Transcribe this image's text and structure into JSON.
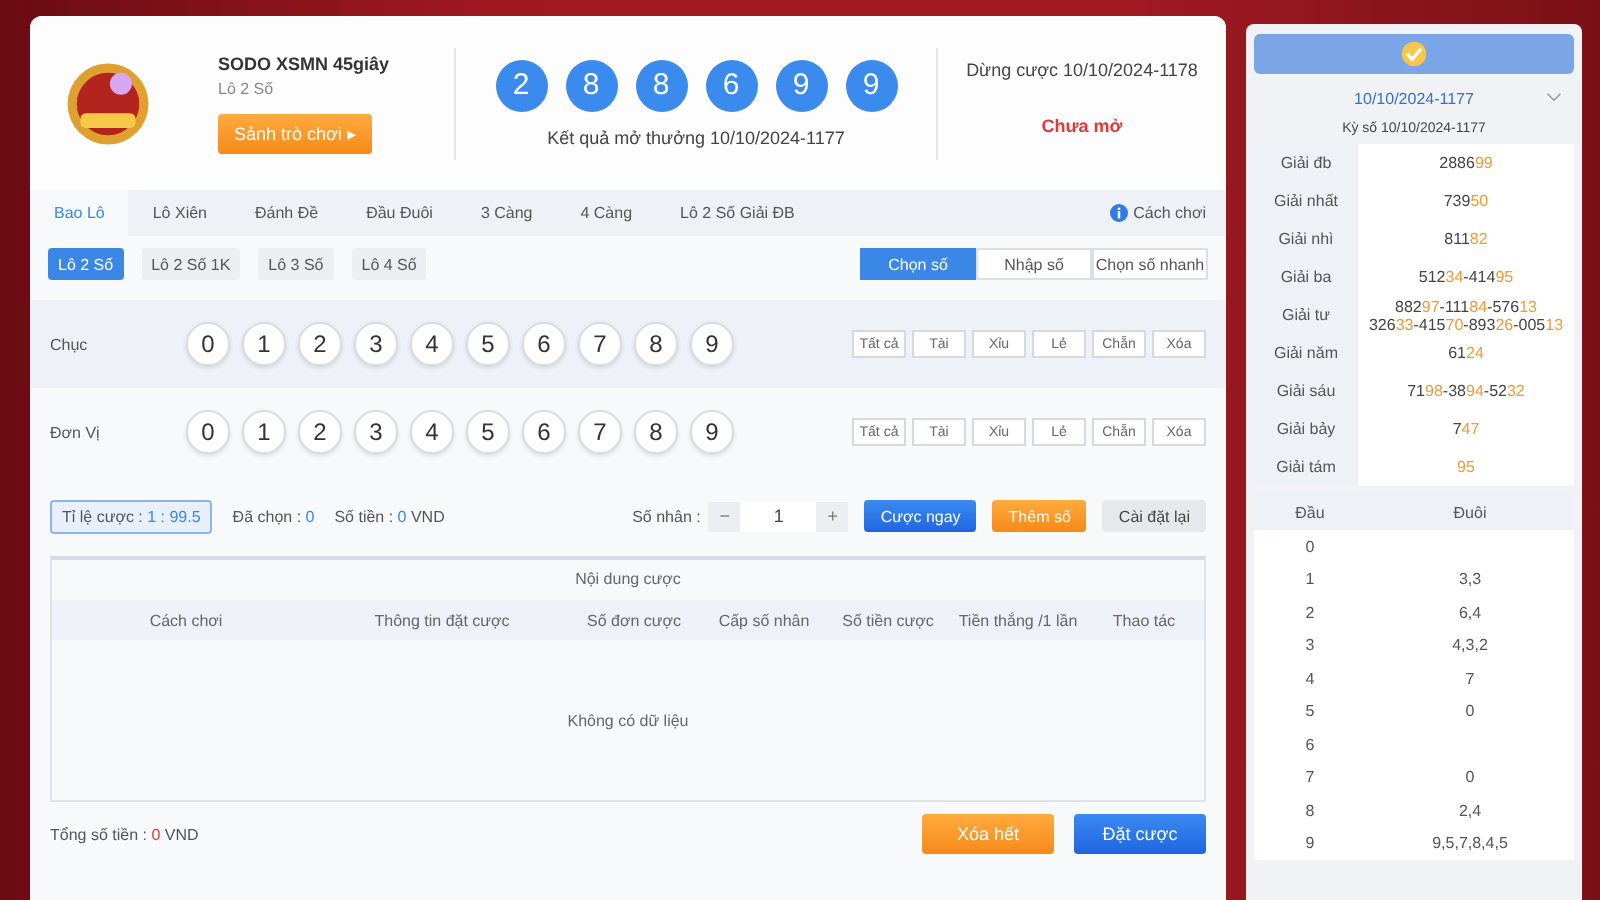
{
  "game": {
    "title": "SODO XSMN 45giây",
    "subtitle": "Lô 2 Số",
    "lobby_button": "Sảnh trò chơi ▸"
  },
  "result": {
    "balls": [
      "2",
      "8",
      "8",
      "6",
      "9",
      "9"
    ],
    "caption": "Kết quả mở thưởng 10/10/2024-1177"
  },
  "next_draw": {
    "label": "Dừng cược 10/10/2024-1178",
    "status": "Chưa mở"
  },
  "tabs": [
    {
      "label": "Bao Lô",
      "selected": true
    },
    {
      "label": "Lô Xiên",
      "selected": false
    },
    {
      "label": "Đánh Đề",
      "selected": false
    },
    {
      "label": "Đầu Đuôi",
      "selected": false
    },
    {
      "label": "3 Càng",
      "selected": false
    },
    {
      "label": "4 Càng",
      "selected": false
    },
    {
      "label": "Lô 2 Số Giải ĐB",
      "selected": false
    }
  ],
  "help_link": "Cách chơi",
  "subtabs": [
    {
      "label": "Lô 2 Số",
      "selected": true
    },
    {
      "label": "Lô 2 Số 1K",
      "selected": false
    },
    {
      "label": "Lô 3 Số",
      "selected": false
    },
    {
      "label": "Lô 4 Số",
      "selected": false
    }
  ],
  "modes": [
    {
      "label": "Chọn số",
      "selected": true
    },
    {
      "label": "Nhập số",
      "selected": false
    },
    {
      "label": "Chọn số nhanh",
      "selected": false
    }
  ],
  "digit_rows": [
    {
      "label": "Chục",
      "digits": [
        {
          "label": "0",
          "selected": false
        },
        {
          "label": "1",
          "selected": false
        },
        {
          "label": "2",
          "selected": false
        },
        {
          "label": "3",
          "selected": false
        },
        {
          "label": "4",
          "selected": false
        },
        {
          "label": "5",
          "selected": false
        },
        {
          "label": "6",
          "selected": false
        },
        {
          "label": "7",
          "selected": false
        },
        {
          "label": "8",
          "selected": false
        },
        {
          "label": "9",
          "selected": false
        }
      ],
      "filters": [
        "Tất cả",
        "Tài",
        "Xỉu",
        "Lẻ",
        "Chẵn",
        "Xóa"
      ]
    },
    {
      "label": "Đơn Vị",
      "digits": [
        {
          "label": "0",
          "selected": false
        },
        {
          "label": "1",
          "selected": false
        },
        {
          "label": "2",
          "selected": false
        },
        {
          "label": "3",
          "selected": false
        },
        {
          "label": "4",
          "selected": false
        },
        {
          "label": "5",
          "selected": false
        },
        {
          "label": "6",
          "selected": false
        },
        {
          "label": "7",
          "selected": false
        },
        {
          "label": "8",
          "selected": false
        },
        {
          "label": "9",
          "selected": false
        }
      ],
      "filters": [
        "Tất cả",
        "Tài",
        "Xỉu",
        "Lẻ",
        "Chẵn",
        "Xóa"
      ]
    }
  ],
  "bet_bar": {
    "odds_label": "Tỉ lệ cược : ",
    "odds_value": "1 : 99.5",
    "chosen_label": "Đã chọn : ",
    "chosen_value": "0",
    "amount_label": "Số tiền : ",
    "amount_value": "0",
    "amount_unit": " VND",
    "multiplier_label": "Số nhân :",
    "minus": "−",
    "multiplier": "1",
    "plus": "+",
    "buttons": [
      {
        "label": "Cược ngay",
        "kind": "primary"
      },
      {
        "label": "Thêm số",
        "kind": "warning"
      },
      {
        "label": "Cài đặt lại",
        "kind": "plain"
      }
    ]
  },
  "bet_table": {
    "title": "Nội dung cược",
    "columns": [
      "Cách chơi",
      "Thông tin đặt cược",
      "Số đơn cược",
      "Cấp số nhân",
      "Số tiền cược",
      "Tiền thắng /1 lần",
      "Thao tác"
    ],
    "empty": "Không có dữ liệu"
  },
  "footer": {
    "total_label": "Tổng số tiền : ",
    "total_value": "0",
    "total_unit": " VND",
    "buttons": [
      {
        "label": "Xóa hết",
        "kind": "warning"
      },
      {
        "label": "Đặt cược",
        "kind": "primary"
      }
    ]
  },
  "results_panel": {
    "date": "10/10/2024-1177",
    "draw": "Kỳ số 10/10/2024-1177",
    "separator": "-",
    "prizes": [
      {
        "name": "Giải đb",
        "lines": [
          [
            [
              "2886",
              "99"
            ]
          ]
        ]
      },
      {
        "name": "Giải nhất",
        "lines": [
          [
            [
              "739",
              "50"
            ]
          ]
        ]
      },
      {
        "name": "Giải nhì",
        "lines": [
          [
            [
              "811",
              "82"
            ]
          ]
        ]
      },
      {
        "name": "Giải ba",
        "lines": [
          [
            [
              "512",
              "34"
            ],
            [
              "414",
              "95"
            ]
          ]
        ]
      },
      {
        "name": "Giải tư",
        "lines": [
          [
            [
              "882",
              "97"
            ],
            [
              "111",
              "84"
            ],
            [
              "576",
              "13"
            ]
          ],
          [
            [
              "326",
              "33"
            ],
            [
              "415",
              "70"
            ],
            [
              "893",
              "26"
            ],
            [
              "005",
              "13"
            ]
          ]
        ]
      },
      {
        "name": "Giải năm",
        "lines": [
          [
            [
              "61",
              "24"
            ]
          ]
        ]
      },
      {
        "name": "Giải sáu",
        "lines": [
          [
            [
              "71",
              "98"
            ],
            [
              "38",
              "94"
            ],
            [
              "52",
              "32"
            ]
          ]
        ]
      },
      {
        "name": "Giải bảy",
        "lines": [
          [
            [
              "7",
              "47"
            ]
          ]
        ]
      },
      {
        "name": "Giải tám",
        "lines": [
          [
            [
              "95"
            ]
          ]
        ]
      }
    ],
    "headtail_columns": [
      "Đầu",
      "Đuôi"
    ],
    "headtail": [
      [
        "0"
      ],
      [
        "1",
        "3,3"
      ],
      [
        "2",
        "6,4"
      ],
      [
        "3",
        "4,3,2"
      ],
      [
        "4",
        "7"
      ],
      [
        "5",
        "0"
      ],
      [
        "6"
      ],
      [
        "7",
        "0"
      ],
      [
        "8",
        "2,4"
      ],
      [
        "9",
        "9,5,7,8,4,5"
      ]
    ]
  }
}
